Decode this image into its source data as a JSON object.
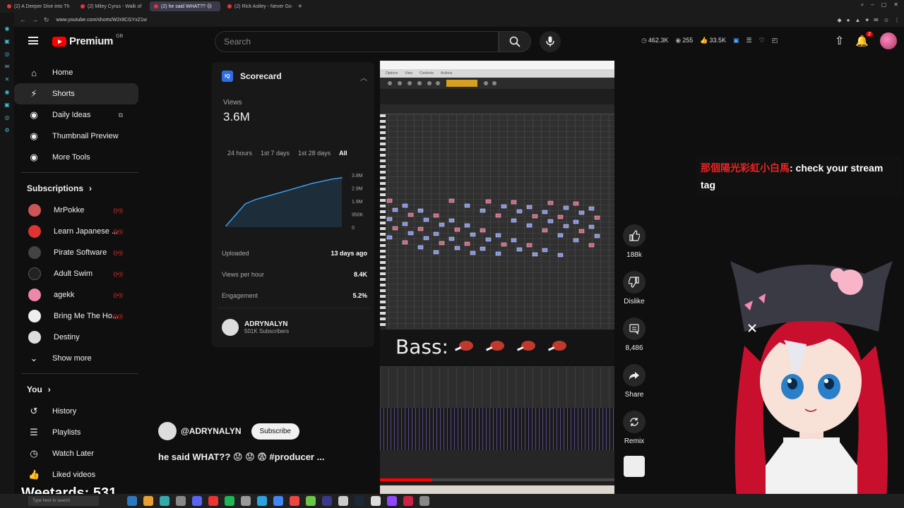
{
  "browser": {
    "tabs": [
      {
        "label": "(2) A Deeper Dive into Th",
        "active": false
      },
      {
        "label": "(2) Miley Cyrus - Walk of",
        "active": false
      },
      {
        "label": "(2) he said WHAT?? ☹",
        "active": true
      },
      {
        "label": "(2) Rick Astley - Never Go",
        "active": false
      }
    ],
    "url": "www.youtube.com/shorts/W2r8CGYxZ1w"
  },
  "header": {
    "logo_text": "Premium",
    "region": "GB",
    "search_placeholder": "Search",
    "stats": {
      "views": "462.3K",
      "watching": "255",
      "likes": "33.5K"
    },
    "notifications": "2"
  },
  "sidebar": {
    "nav": [
      {
        "label": "Home",
        "icon": "home-icon"
      },
      {
        "label": "Shorts",
        "icon": "shorts-icon",
        "selected": true
      },
      {
        "label": "Daily Ideas",
        "icon": "tool-icon",
        "external": true
      },
      {
        "label": "Thumbnail Preview",
        "icon": "tool-icon"
      },
      {
        "label": "More Tools",
        "icon": "tool-icon"
      }
    ],
    "subscriptions_title": "Subscriptions",
    "subscriptions": [
      {
        "label": "MrPokke",
        "color": "#c55"
      },
      {
        "label": "Learn Japanese ...",
        "color": "#d33"
      },
      {
        "label": "Pirate Software",
        "color": "#444"
      },
      {
        "label": "Adult Swim",
        "color": "#222"
      },
      {
        "label": "agekk",
        "color": "#e8a"
      },
      {
        "label": "Bring Me The Ho...",
        "color": "#eee"
      },
      {
        "label": "Destiny",
        "color": "#ddd"
      }
    ],
    "show_more": "Show more",
    "you_title": "You",
    "you_items": [
      {
        "label": "History",
        "icon": "history-icon"
      },
      {
        "label": "Playlists",
        "icon": "playlists-icon"
      },
      {
        "label": "Watch Later",
        "icon": "clock-icon"
      },
      {
        "label": "Liked videos",
        "icon": "thumbs-up-icon"
      }
    ]
  },
  "scorecard": {
    "title": "Scorecard",
    "views_label": "Views",
    "views_value": "3.6M",
    "ranges": [
      "24 hours",
      "1st 7 days",
      "1st 28 days",
      "All"
    ],
    "active_range": "All",
    "y_ticks": [
      "3.8M",
      "2.9M",
      "1.9M",
      "950K",
      "0"
    ],
    "rows": [
      {
        "label": "Uploaded",
        "value": "13 days ago"
      },
      {
        "label": "Views per hour",
        "value": "8.4K"
      },
      {
        "label": "Engagement",
        "value": "5.2%"
      }
    ],
    "channel_name": "ADRYNALYN",
    "channel_subs": "501K Subscribers"
  },
  "chart_data": {
    "type": "line",
    "x": [
      0,
      1,
      2,
      3,
      4,
      5,
      6,
      7,
      8,
      9,
      10,
      11,
      12
    ],
    "values": [
      0.1,
      0.9,
      1.7,
      2.0,
      2.2,
      2.4,
      2.6,
      2.8,
      3.0,
      3.2,
      3.35,
      3.5,
      3.6
    ],
    "y_ticks": [
      "3.8M",
      "2.9M",
      "1.9M",
      "950K",
      "0"
    ],
    "ylim": [
      0,
      3.8
    ],
    "color": "#3ea6ff"
  },
  "video": {
    "menu_items": [
      "Options",
      "View",
      "Contents",
      "Actions"
    ],
    "overlay_text": "Bass:",
    "progress": 0.22
  },
  "actions": [
    {
      "label": "188k",
      "icon": "thumbs-up-icon"
    },
    {
      "label": "Dislike",
      "icon": "thumbs-down-icon"
    },
    {
      "label": "8,486",
      "icon": "comment-icon"
    },
    {
      "label": "Share",
      "icon": "share-icon"
    },
    {
      "label": "Remix",
      "icon": "remix-icon"
    }
  ],
  "meta": {
    "channel": "@ADRYNALYN",
    "subscribe": "Subscribe",
    "title": "he said WHAT?? 😟 😟 😨 #producer ..."
  },
  "chat": {
    "user": "那個陽光彩虹小白馬",
    "message": ": check your stream tag"
  },
  "overlay_counter": "Weetards: 531",
  "taskbar": {
    "search_placeholder": "Type here to search"
  }
}
